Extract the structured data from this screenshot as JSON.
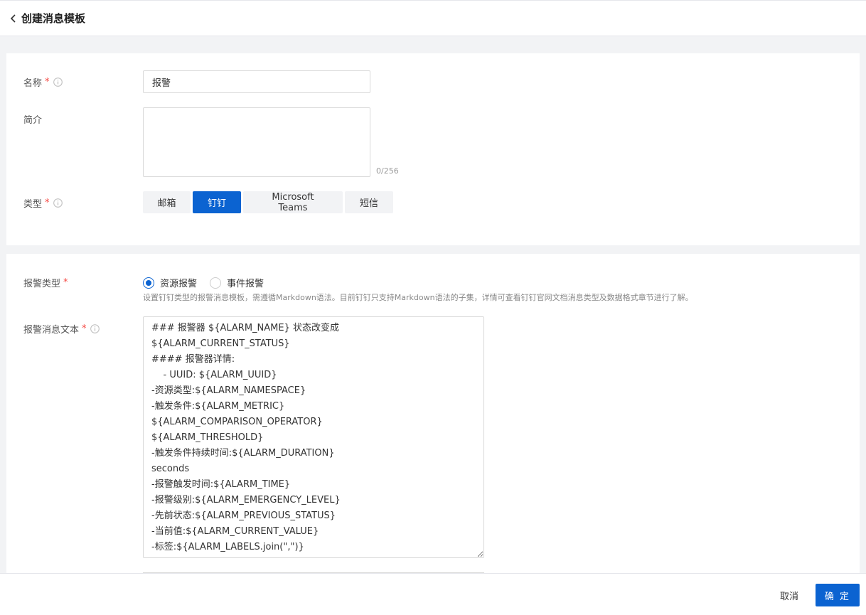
{
  "header": {
    "title": "创建消息模板"
  },
  "form": {
    "name": {
      "label": "名称",
      "required": "*",
      "value": "报警"
    },
    "intro": {
      "label": "简介",
      "value": "",
      "counter": "0/256"
    },
    "type": {
      "label": "类型",
      "required": "*",
      "options": [
        "邮箱",
        "钉钉",
        "Microsoft Teams",
        "短信"
      ],
      "selected": "钉钉"
    },
    "alarm_type": {
      "label": "报警类型",
      "required": "*",
      "options": [
        "资源报警",
        "事件报警"
      ],
      "selected": "资源报警",
      "hint": "设置钉钉类型的报警消息模板，需遵循Markdown语法。目前钉钉只支持Markdown语法的子集，详情可查看钉钉官网文档消息类型及数据格式章节进行了解。"
    },
    "message": {
      "label": "报警消息文本",
      "required": "*",
      "value": "### 报警器 ${ALARM_NAME} 状态改变成\n${ALARM_CURRENT_STATUS}\n#### 报警器详情:\n    - UUID: ${ALARM_UUID}\n-资源类型:${ALARM_NAMESPACE}\n-触发条件:${ALARM_METRIC}\n${ALARM_COMPARISON_OPERATOR}\n${ALARM_THRESHOLD}\n-触发条件持续时间:${ALARM_DURATION}\nseconds\n-报警触发时间:${ALARM_TIME}\n-报警级别:${ALARM_EMERGENCY_LEVEL}\n-先前状态:${ALARM_PREVIOUS_STATUS}\n-当前值:${ALARM_CURRENT_VALUE}\n-标签:${ALARM_LABELS.join(\",\")}"
    }
  },
  "footer": {
    "cancel": "取消",
    "confirm": "确 定"
  },
  "colors": {
    "primary": "#0b63d1",
    "required": "#f54a45"
  }
}
